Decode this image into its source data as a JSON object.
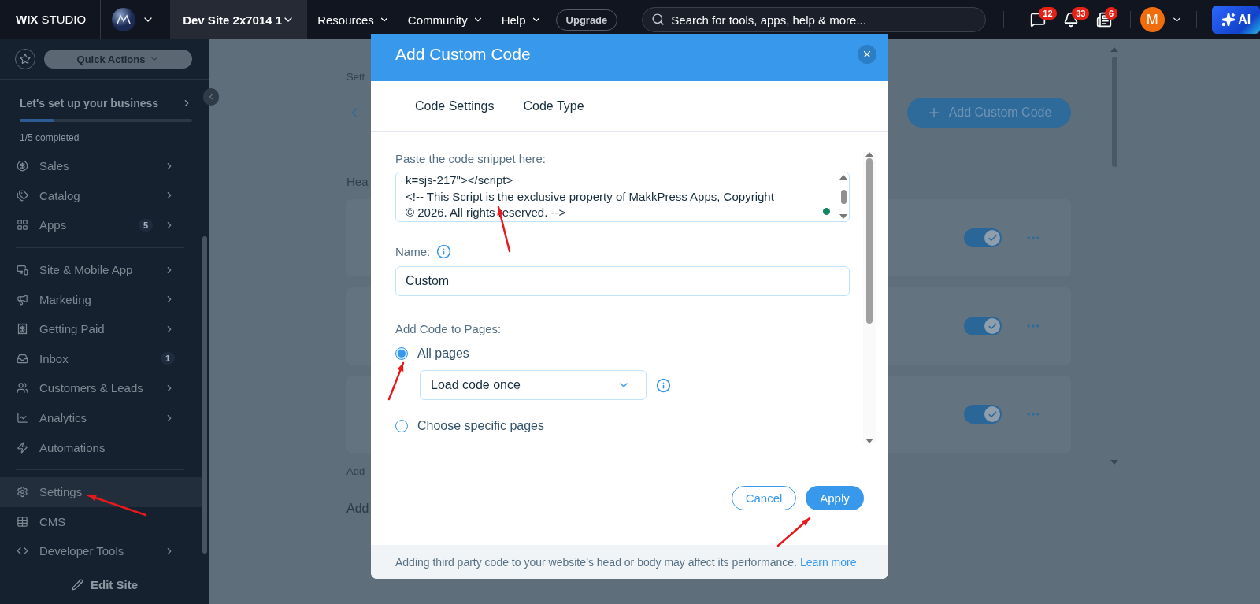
{
  "topbar": {
    "logo": "**WIX** STUDIO",
    "site_switcher": "Dev Site 2x7014 1",
    "menus": [
      "Resources",
      "Community",
      "Help"
    ],
    "upgrade": "Upgrade",
    "search": {
      "placeholder": "Search for tools, apps, help & more..."
    },
    "notifications": [
      {
        "kind": "chat",
        "count": "12"
      },
      {
        "kind": "bell",
        "count": "33"
      },
      {
        "kind": "news",
        "count": "6"
      }
    ],
    "account": {
      "initial": "M"
    },
    "ai_button": "AI"
  },
  "sidebar": {
    "quick_actions": "Quick Actions",
    "setup": {
      "title": "Let's set up your business",
      "level": 0.2,
      "progress": "1/5 completed"
    },
    "groups": [
      [
        {
          "kind": "sales",
          "label": "Sales",
          "submenu": true,
          "selected": false
        },
        {
          "kind": "catalog",
          "label": "Catalog",
          "submenu": true,
          "selected": false
        },
        {
          "kind": "apps",
          "label": "Apps",
          "badge": "5",
          "submenu": true,
          "selected": false
        }
      ],
      [
        {
          "kind": "site",
          "label": "Site & Mobile App",
          "submenu": true,
          "selected": false
        },
        {
          "kind": "marketing",
          "label": "Marketing",
          "submenu": true,
          "selected": false
        },
        {
          "kind": "paid",
          "label": "Getting Paid",
          "submenu": true,
          "selected": false
        },
        {
          "kind": "inbox",
          "label": "Inbox",
          "badge": "1",
          "submenu": false,
          "selected": false
        },
        {
          "kind": "customers",
          "label": "Customers & Leads",
          "submenu": true,
          "selected": false
        },
        {
          "kind": "analytics",
          "label": "Analytics",
          "submenu": true,
          "selected": false
        },
        {
          "kind": "automations",
          "label": "Automations",
          "submenu": false,
          "selected": false
        }
      ],
      [
        {
          "kind": "settings",
          "label": "Settings",
          "submenu": false,
          "selected": true
        },
        {
          "kind": "cms",
          "label": "CMS",
          "submenu": false,
          "selected": false
        },
        {
          "kind": "developer",
          "label": "Developer Tools",
          "submenu": true,
          "selected": false
        }
      ]
    ],
    "edit_site": "Edit Site"
  },
  "main": {
    "breadcrumb": "Sett",
    "add_button": "Add Custom Code",
    "section_heading": "Hea",
    "cards": [
      {
        "on": true
      },
      {
        "on": true
      },
      {
        "on": true
      }
    ],
    "footnote": "Add",
    "heading": "Add"
  },
  "dialog": {
    "title": "Add Custom Code",
    "tabs": [
      "Code Settings",
      "Code Type"
    ],
    "code_label": "Paste the code snippet here:",
    "code_lines": [
      "k=sjs-217\"></script>",
      "<!-- This Script is the exclusive property of MakkPress Apps, Copyright",
      "© 2026. All rights reserved. -->"
    ],
    "name_label": "Name:",
    "name_value": "Custom",
    "pages_label": "Add Code to Pages:",
    "options": [
      {
        "label": "All pages",
        "selected": true
      },
      {
        "label": "Choose specific pages",
        "selected": false
      }
    ],
    "load_select": "Load code once",
    "cancel": "Cancel",
    "apply": "Apply",
    "footer": {
      "text": "Adding third party code to your website’s head or body may affect its performance.",
      "link": "Learn more"
    }
  }
}
